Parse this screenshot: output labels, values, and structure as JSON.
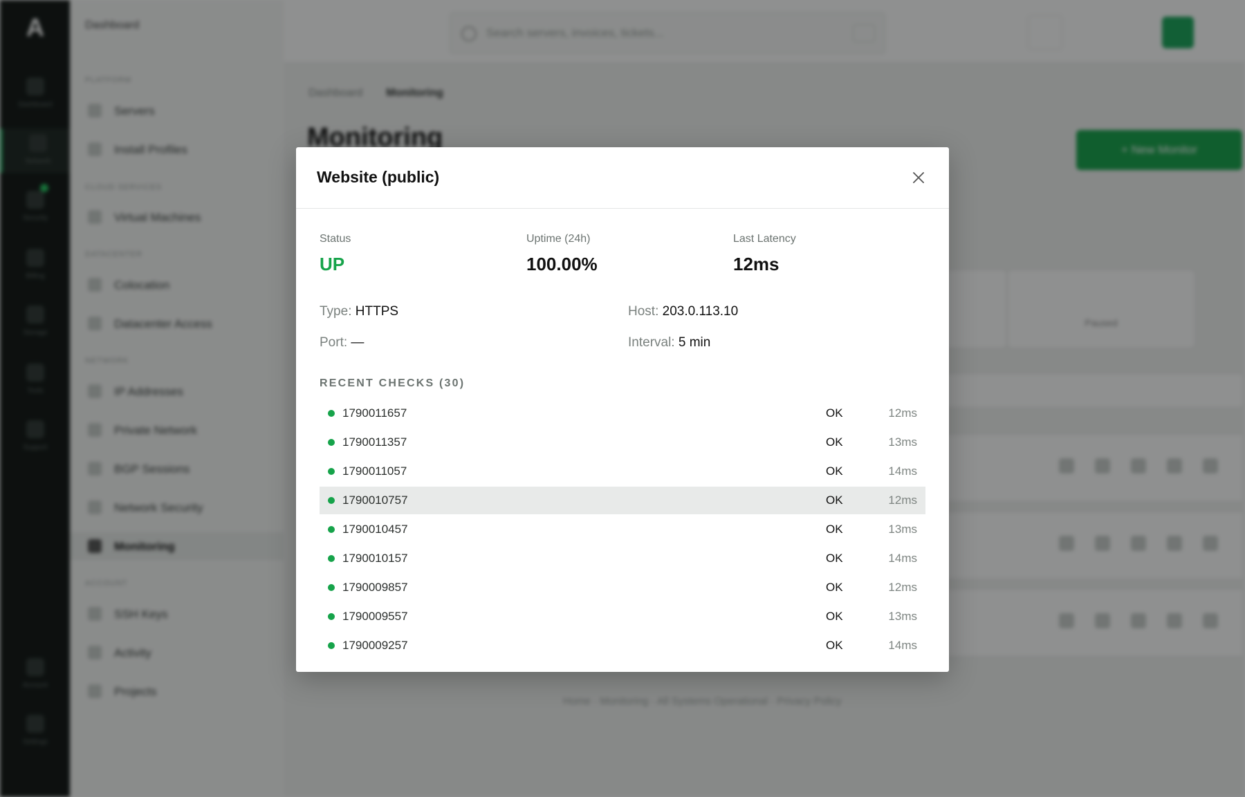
{
  "background": {
    "brand": "Dashboard",
    "rail_items": [
      "Dashboard",
      "Network",
      "Security",
      "Billing",
      "Storage",
      "Tools",
      "Support",
      "Account",
      "Settings"
    ],
    "sidebar": {
      "sections": [
        "PLATFORM",
        "CLOUD SERVICES",
        "DATACENTER",
        "NETWORK",
        "ACCOUNT"
      ],
      "items": [
        "Servers",
        "Install Profiles",
        "Virtual Machines",
        "Colocation",
        "Datacenter Access",
        "IP Addresses",
        "Private Network",
        "BGP Sessions",
        "Network Security",
        "Monitoring",
        "SSH Keys",
        "Activity",
        "Projects"
      ]
    },
    "search_placeholder": "Search servers, invoices, tickets...",
    "breadcrumb_root": "Dashboard",
    "breadcrumb_current": "Monitoring",
    "page_title": "Monitoring",
    "new_button": "+ New Monitor",
    "stat_card_label": "Paused",
    "footer": "Home · Monitoring · All Systems Operational · Privacy Policy",
    "accent_color": "#16a34a"
  },
  "modal": {
    "title": "Website (public)",
    "close_icon": "close-icon",
    "status_label": "Status",
    "status_value": "UP",
    "uptime_label": "Uptime (24h)",
    "uptime_value": "100.00%",
    "latency_label": "Last Latency",
    "latency_value": "12ms",
    "type_label": "Type:",
    "type_value": "HTTPS",
    "host_label": "Host:",
    "host_value": "203.0.113.10",
    "port_label": "Port:",
    "port_value": "—",
    "interval_label": "Interval:",
    "interval_value": "5 min",
    "recent_checks_title": "RECENT CHECKS (30)",
    "checks": [
      {
        "ts": "1790011657",
        "status": "OK",
        "latency": "12ms"
      },
      {
        "ts": "1790011357",
        "status": "OK",
        "latency": "13ms"
      },
      {
        "ts": "1790011057",
        "status": "OK",
        "latency": "14ms"
      },
      {
        "ts": "1790010757",
        "status": "OK",
        "latency": "12ms"
      },
      {
        "ts": "1790010457",
        "status": "OK",
        "latency": "13ms"
      },
      {
        "ts": "1790010157",
        "status": "OK",
        "latency": "14ms"
      },
      {
        "ts": "1790009857",
        "status": "OK",
        "latency": "12ms"
      },
      {
        "ts": "1790009557",
        "status": "OK",
        "latency": "13ms"
      },
      {
        "ts": "1790009257",
        "status": "OK",
        "latency": "14ms"
      }
    ]
  }
}
